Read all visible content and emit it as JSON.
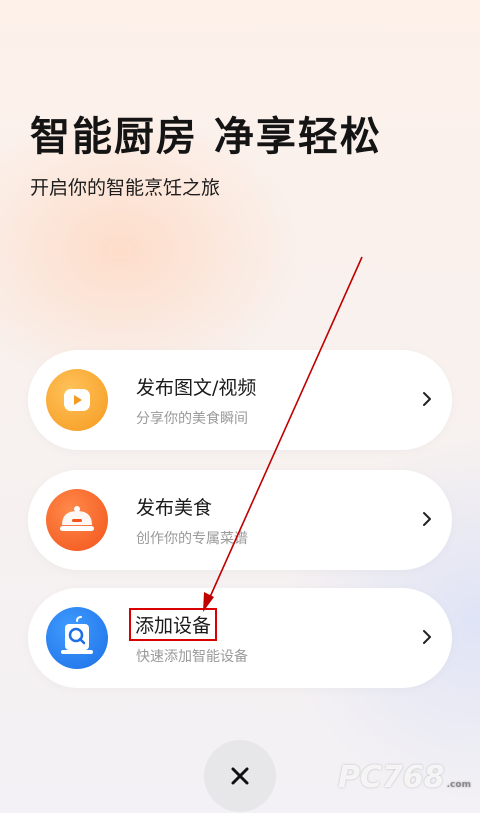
{
  "header": {
    "title": "智能厨房 净享轻松",
    "subtitle": "开启你的智能烹饪之旅"
  },
  "cards": [
    {
      "title": "发布图文/视频",
      "subtitle": "分享你的美食瞬间",
      "icon": "video-play-icon",
      "color": "#f7a02a"
    },
    {
      "title": "发布美食",
      "subtitle": "创作你的专属菜谱",
      "icon": "food-dish-icon",
      "color": "#f35a22"
    },
    {
      "title": "添加设备",
      "subtitle": "快速添加智能设备",
      "icon": "device-add-icon",
      "color": "#2a7ff0"
    }
  ],
  "close": {
    "icon": "close-icon"
  },
  "watermark": {
    "text": "PC768",
    "suffix": ".com"
  },
  "annotation": {
    "color": "#d90000"
  }
}
